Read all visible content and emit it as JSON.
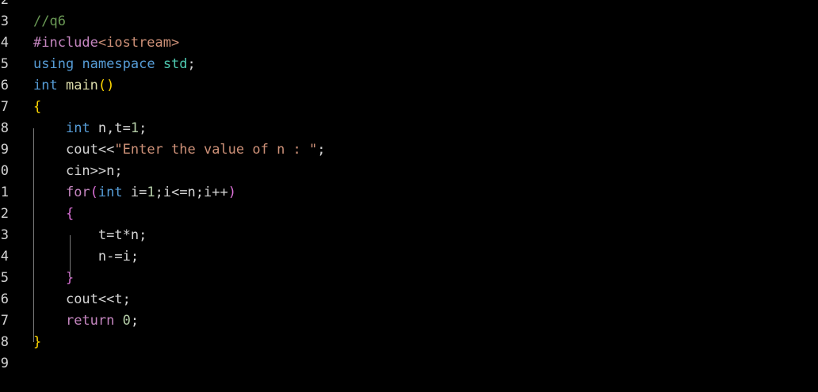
{
  "gutter": {
    "line_numbers": [
      "2",
      "3",
      "4",
      "5",
      "6",
      "7",
      "8",
      "9",
      "0",
      "1",
      "2",
      "3",
      "4",
      "5",
      "6",
      "7",
      "8",
      "9"
    ]
  },
  "code": {
    "lines": [
      [],
      [
        {
          "t": "//q6",
          "c": "comment"
        }
      ],
      [
        {
          "t": "#include",
          "c": "directive"
        },
        {
          "t": "<iostream>",
          "c": "header"
        }
      ],
      [
        {
          "t": "using",
          "c": "keyword"
        },
        {
          "t": " ",
          "c": "text"
        },
        {
          "t": "namespace",
          "c": "keyword"
        },
        {
          "t": " ",
          "c": "text"
        },
        {
          "t": "std",
          "c": "namespace"
        },
        {
          "t": ";",
          "c": "text"
        }
      ],
      [
        {
          "t": "int",
          "c": "keyword"
        },
        {
          "t": " ",
          "c": "text"
        },
        {
          "t": "main",
          "c": "func"
        },
        {
          "t": "()",
          "c": "brace1"
        }
      ],
      [
        {
          "t": "{",
          "c": "brace1"
        }
      ],
      [
        {
          "t": "    ",
          "c": "text"
        },
        {
          "t": "int",
          "c": "keyword"
        },
        {
          "t": " n,t=",
          "c": "text"
        },
        {
          "t": "1",
          "c": "number"
        },
        {
          "t": ";",
          "c": "text"
        }
      ],
      [
        {
          "t": "    ",
          "c": "text"
        },
        {
          "t": "cout<<",
          "c": "text"
        },
        {
          "t": "\"Enter the value of n : \"",
          "c": "string"
        },
        {
          "t": ";",
          "c": "text"
        }
      ],
      [
        {
          "t": "    ",
          "c": "text"
        },
        {
          "t": "cin>>n;",
          "c": "text"
        }
      ],
      [
        {
          "t": "    ",
          "c": "text"
        },
        {
          "t": "for",
          "c": "control"
        },
        {
          "t": "(",
          "c": "brace2"
        },
        {
          "t": "int",
          "c": "keyword"
        },
        {
          "t": " i=",
          "c": "text"
        },
        {
          "t": "1",
          "c": "number"
        },
        {
          "t": ";i<=n;i++",
          "c": "text"
        },
        {
          "t": ")",
          "c": "brace2"
        }
      ],
      [
        {
          "t": "    ",
          "c": "text"
        },
        {
          "t": "{",
          "c": "brace2"
        }
      ],
      [
        {
          "t": "        ",
          "c": "text"
        },
        {
          "t": "t=t*n;",
          "c": "text"
        }
      ],
      [
        {
          "t": "        ",
          "c": "text"
        },
        {
          "t": "n-=i;",
          "c": "text"
        }
      ],
      [
        {
          "t": "    ",
          "c": "text"
        },
        {
          "t": "}",
          "c": "brace2"
        }
      ],
      [
        {
          "t": "    ",
          "c": "text"
        },
        {
          "t": "cout<<t;",
          "c": "text"
        }
      ],
      [
        {
          "t": "    ",
          "c": "text"
        },
        {
          "t": "return",
          "c": "control"
        },
        {
          "t": " ",
          "c": "text"
        },
        {
          "t": "0",
          "c": "number"
        },
        {
          "t": ";",
          "c": "text"
        }
      ],
      [
        {
          "t": "}",
          "c": "brace1"
        }
      ],
      []
    ]
  },
  "colors": {
    "background": "#000000",
    "comment": "#6a9955",
    "keyword": "#569cd6",
    "string": "#ce9178",
    "number": "#b5cea8",
    "brace_outer": "#ffd700",
    "brace_inner": "#da70d6"
  }
}
